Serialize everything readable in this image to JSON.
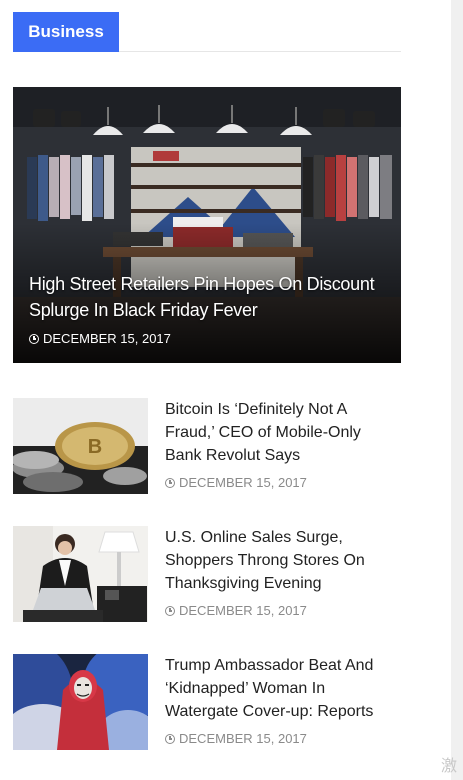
{
  "section": {
    "label": "Business"
  },
  "featured": {
    "title": "High Street Retailers Pin Hopes On Discount Splurge In Black Friday Fever",
    "date": "DECEMBER 15, 2017",
    "image_icon": "clothing-store-photo"
  },
  "posts": [
    {
      "title": "Bitcoin Is ‘Definitely Not A Fraud,’ CEO of Mobile-Only Bank Revolut Says",
      "date": "DECEMBER 15, 2017",
      "image_icon": "bitcoin-coins-photo"
    },
    {
      "title": "U.S. Online Sales Surge, Shoppers Throng Stores On Thanksgiving Evening",
      "date": "DECEMBER 15, 2017",
      "image_icon": "woman-laptop-photo"
    },
    {
      "title": "Trump Ambassador Beat And ‘Kidnapped’ Woman In Watergate Cover-up: Reports",
      "date": "DECEMBER 15, 2017",
      "image_icon": "masked-person-smoke-photo"
    }
  ],
  "watermark": "激",
  "colors": {
    "accent": "#3b6cf5",
    "text": "#222222",
    "meta": "#8a8a8a"
  }
}
